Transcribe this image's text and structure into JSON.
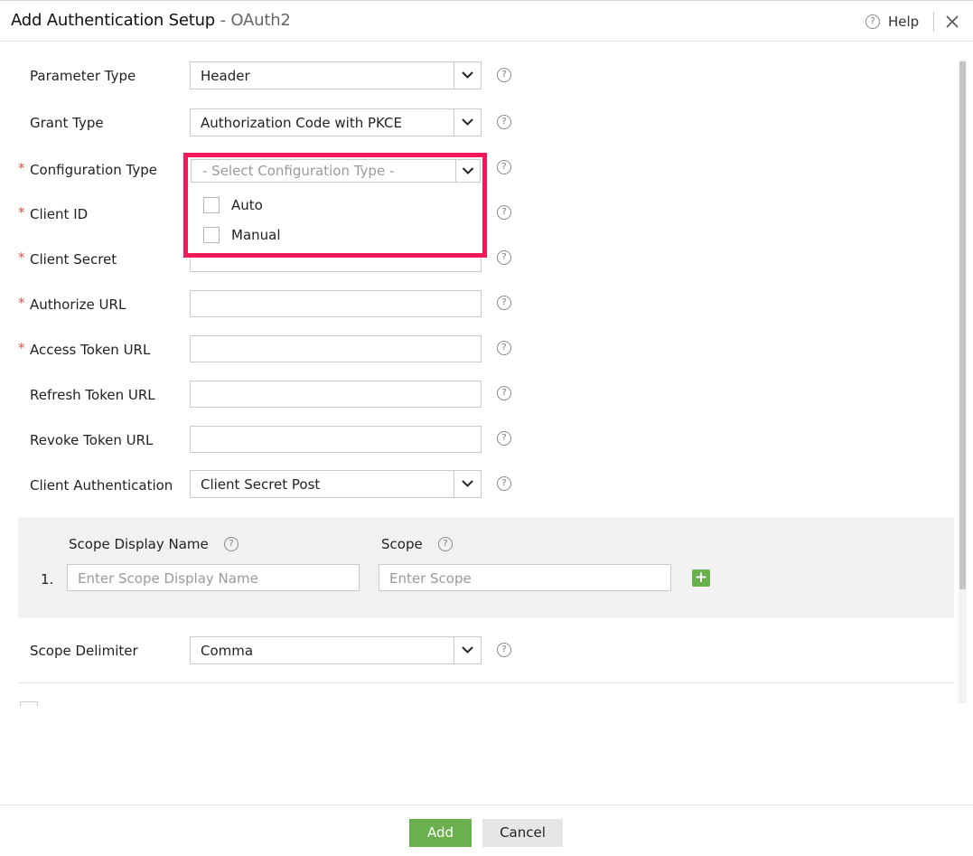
{
  "header": {
    "title": "Add Authentication Setup",
    "separator": " - ",
    "subtitle": "OAuth2",
    "help_label": "Help",
    "help_glyph": "?"
  },
  "form": {
    "parameter_type": {
      "label": "Parameter Type",
      "value": "Header"
    },
    "grant_type": {
      "label": "Grant Type",
      "value": "Authorization Code with PKCE"
    },
    "configuration_type": {
      "label": "Configuration Type",
      "placeholder": "- Select Configuration Type -",
      "options": [
        "Auto",
        "Manual"
      ]
    },
    "client_id": {
      "label": "Client ID",
      "value": ""
    },
    "client_secret": {
      "label": "Client Secret",
      "value": ""
    },
    "authorize_url": {
      "label": "Authorize URL",
      "value": ""
    },
    "access_token_url": {
      "label": "Access Token URL",
      "value": ""
    },
    "refresh_token_url": {
      "label": "Refresh Token URL",
      "value": ""
    },
    "revoke_token_url": {
      "label": "Revoke Token URL",
      "value": ""
    },
    "client_authentication": {
      "label": "Client Authentication",
      "value": "Client Secret Post"
    },
    "scope_delimiter": {
      "label": "Scope Delimiter",
      "value": "Comma"
    },
    "required_marker": "*"
  },
  "scopes": {
    "display_name_header": "Scope Display Name",
    "scope_header": "Scope",
    "rows": [
      {
        "index": "1.",
        "display_name_placeholder": "Enter Scope Display Name",
        "scope_placeholder": "Enter Scope"
      }
    ],
    "add_glyph": "+"
  },
  "footer": {
    "add_label": "Add",
    "cancel_label": "Cancel"
  },
  "colors": {
    "accent_green": "#6ab04c",
    "highlight_pink": "#f0195a",
    "required_red": "#d9534f"
  },
  "icons": {
    "help": "question-circle-icon",
    "close": "close-icon",
    "dropdown": "chevron-down-icon",
    "add_scope": "plus-icon"
  }
}
